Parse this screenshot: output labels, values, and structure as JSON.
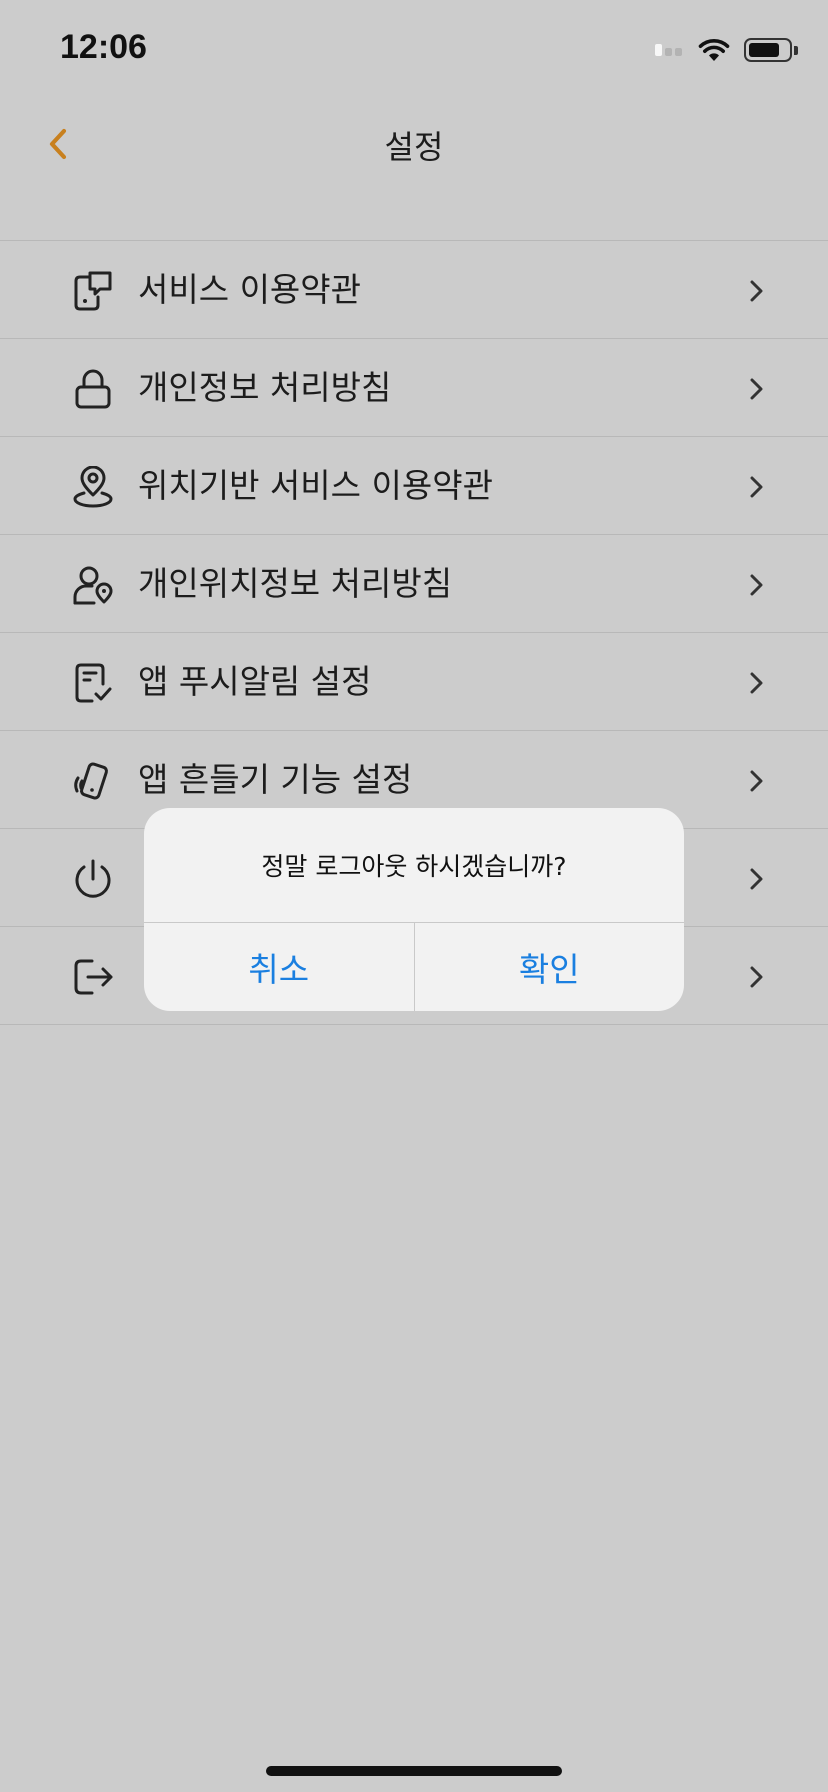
{
  "status_bar": {
    "time": "12:06",
    "battery_level": 0.8
  },
  "nav": {
    "title": "설정",
    "back_icon": "chevron-left-icon",
    "accent_color": "#c8801e"
  },
  "menu": {
    "items": [
      {
        "label": "서비스 이용약관",
        "icon": "terms-document-icon"
      },
      {
        "label": "개인정보 처리방침",
        "icon": "lock-icon"
      },
      {
        "label": "위치기반 서비스 이용약관",
        "icon": "location-pin-icon"
      },
      {
        "label": "개인위치정보 처리방침",
        "icon": "person-location-icon"
      },
      {
        "label": "앱 푸시알림 설정",
        "icon": "notification-checklist-icon"
      },
      {
        "label": "앱 흔들기 기능 설정",
        "icon": "shake-phone-icon"
      },
      {
        "label": "",
        "icon": "power-icon"
      },
      {
        "label": "",
        "icon": "logout-icon"
      }
    ]
  },
  "alert": {
    "message": "정말 로그아웃 하시겠습니까?",
    "cancel_label": "취소",
    "confirm_label": "확인",
    "button_color": "#1a7fe0"
  }
}
